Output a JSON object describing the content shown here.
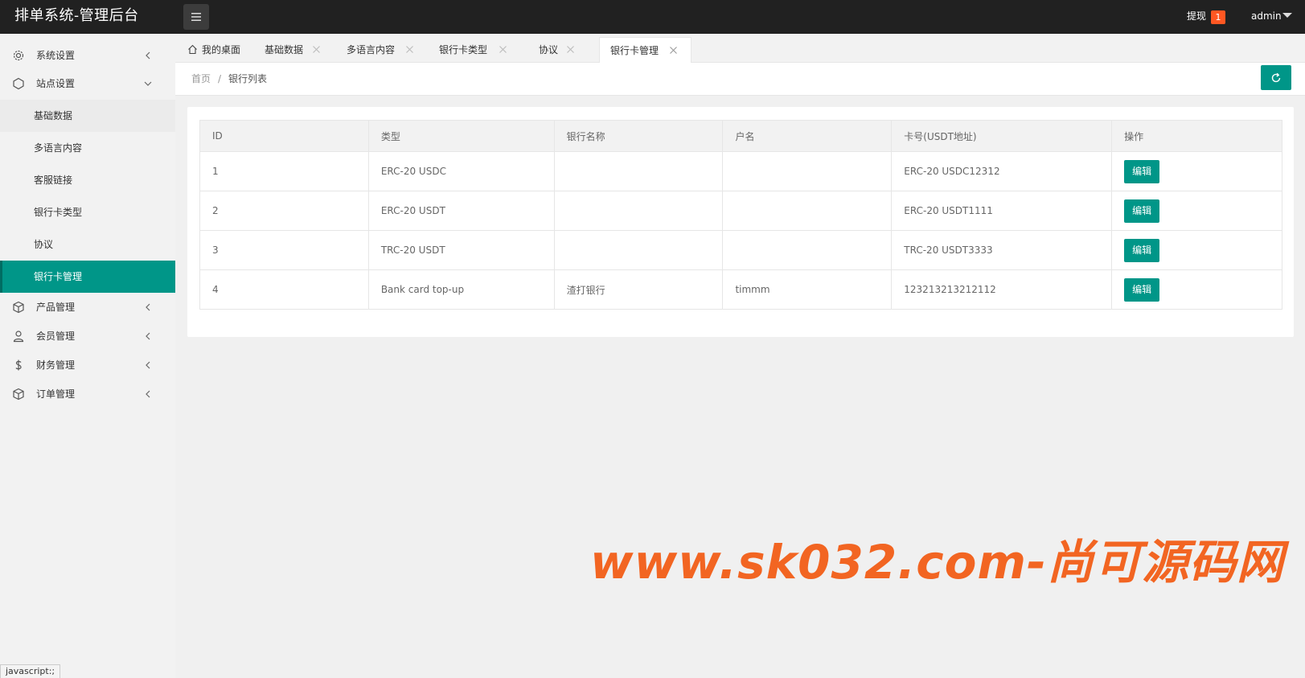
{
  "header": {
    "logo": "排单系统-管理后台",
    "withdraw_label": "提现",
    "withdraw_count": "1",
    "user": "admin"
  },
  "sidebar": {
    "items": [
      {
        "label": "系统设置",
        "icon": "gear-icon",
        "state": "collapsed"
      },
      {
        "label": "站点设置",
        "icon": "site-icon",
        "state": "expanded",
        "children": [
          "基础数据",
          "多语言内容",
          "客服链接",
          "银行卡类型",
          "协议",
          "银行卡管理"
        ]
      },
      {
        "label": "产品管理",
        "icon": "box-icon",
        "state": "collapsed"
      },
      {
        "label": "会员管理",
        "icon": "user-icon",
        "state": "collapsed"
      },
      {
        "label": "财务管理",
        "icon": "dollar-icon",
        "state": "collapsed"
      },
      {
        "label": "订单管理",
        "icon": "box-icon",
        "state": "collapsed"
      }
    ],
    "active_child": "银行卡管理"
  },
  "tabs": [
    {
      "label": "我的桌面",
      "home": true
    },
    {
      "label": "基础数据"
    },
    {
      "label": "多语言内容"
    },
    {
      "label": "银行卡类型"
    },
    {
      "label": "协议"
    },
    {
      "label": "银行卡管理",
      "active": true
    }
  ],
  "breadcrumb": {
    "home": "首页",
    "separator": "/",
    "current": "银行列表"
  },
  "table": {
    "columns": [
      "ID",
      "类型",
      "银行名称",
      "户名",
      "卡号(USDT地址)",
      "操作"
    ],
    "rows": [
      {
        "id": "1",
        "type": "ERC-20 USDC",
        "bank": "",
        "holder": "",
        "card": "ERC-20 USDC12312",
        "action": "编辑"
      },
      {
        "id": "2",
        "type": "ERC-20 USDT",
        "bank": "",
        "holder": "",
        "card": "ERC-20 USDT1111",
        "action": "编辑"
      },
      {
        "id": "3",
        "type": "TRC-20 USDT",
        "bank": "",
        "holder": "",
        "card": "TRC-20 USDT3333",
        "action": "编辑"
      },
      {
        "id": "4",
        "type": "Bank card top-up",
        "bank": "渣打银行",
        "holder": "timmm",
        "card": "123213213212112",
        "action": "编辑"
      }
    ]
  },
  "watermark": "www.sk032.com-尚可源码网",
  "statusbar": "javascript:;",
  "colors": {
    "header_bg": "#212121",
    "accent": "#009688",
    "badge": "#ff5722",
    "watermark": "#f26522"
  }
}
